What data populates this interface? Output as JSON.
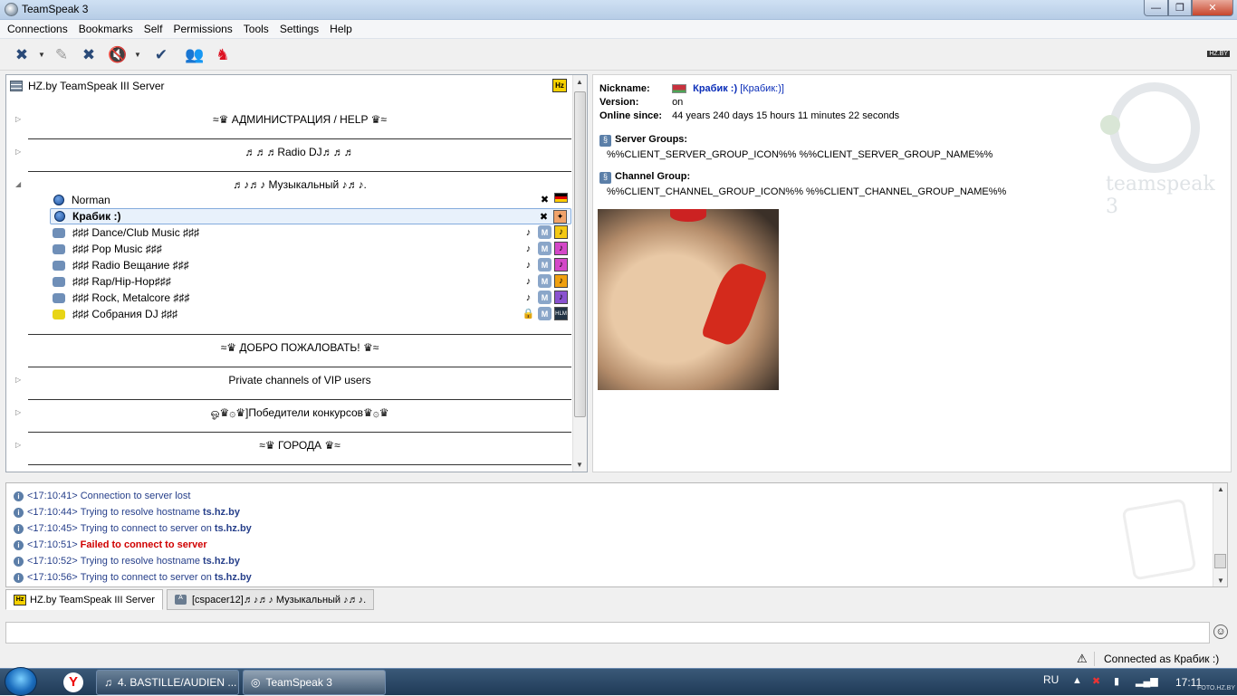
{
  "window": {
    "title": "TeamSpeak 3",
    "min": "—",
    "max": "❐",
    "close": "✕"
  },
  "menu": [
    "Connections",
    "Bookmarks",
    "Self",
    "Permissions",
    "Tools",
    "Settings",
    "Help"
  ],
  "toolbar": {
    "hz_label": "HZ.BY"
  },
  "tree": {
    "server_name": "HZ.by TeamSpeak III Server",
    "server_badge": "Hz",
    "spacers": [
      "≈♛ АДМИНИСТРАЦИЯ / HELP ♛≈",
      "♬♬♬Radio DJ♬♬♬",
      "♬♪♬♪ Музыкальный ♪♬♪.",
      "≈♛ ДОБРО ПОЖАЛОВАТЬ! ♛≈",
      "Private channels of VIP users",
      "ஓ♛۞♛]Победители конкурсов♛۞♛",
      "≈♛ ГОРОДА ♛≈"
    ],
    "clients": [
      {
        "name": "Norman"
      },
      {
        "name": "Крабик :)"
      }
    ],
    "channels": [
      {
        "name": "♯♯♯ Dance/Club Music ♯♯♯"
      },
      {
        "name": "♯♯♯ Pop Music ♯♯♯"
      },
      {
        "name": "♯♯♯ Radio Вещание ♯♯♯"
      },
      {
        "name": "♯♯♯ Rap/Hip-Hop♯♯♯"
      },
      {
        "name": "♯♯♯ Rock, Metalcore ♯♯♯"
      },
      {
        "name": "♯♯♯ Собрания DJ ♯♯♯"
      }
    ]
  },
  "info": {
    "nickname_label": "Nickname:",
    "nickname": "Крабик :)",
    "nickname_link": "[Крабик:)]",
    "version_label": "Version:",
    "version": "on",
    "online_label": "Online since:",
    "online": "44 years 240 days 15 hours 11 minutes 22 seconds",
    "server_groups_label": "Server Groups:",
    "server_groups": "%%CLIENT_SERVER_GROUP_ICON%% %%CLIENT_SERVER_GROUP_NAME%%",
    "channel_group_label": "Channel Group:",
    "channel_group": "%%CLIENT_CHANNEL_GROUP_ICON%% %%CLIENT_CHANNEL_GROUP_NAME%%",
    "logo_text": "teamspeak 3"
  },
  "log": [
    {
      "time": "<17:10:41>",
      "text": "Connection to server lost",
      "host": "",
      "error": ""
    },
    {
      "time": "<17:10:44>",
      "text": "Trying to resolve hostname",
      "host": "ts.hz.by",
      "error": ""
    },
    {
      "time": "<17:10:45>",
      "text": "Trying to connect to server on",
      "host": "ts.hz.by",
      "error": ""
    },
    {
      "time": "<17:10:51>",
      "text": "",
      "host": "",
      "error": "Failed to connect to server"
    },
    {
      "time": "<17:10:52>",
      "text": "Trying to resolve hostname",
      "host": "ts.hz.by",
      "error": ""
    },
    {
      "time": "<17:10:56>",
      "text": "Trying to connect to server on",
      "host": "ts.hz.by",
      "error": ""
    }
  ],
  "tabs": [
    {
      "label": "HZ.by TeamSpeak III Server"
    },
    {
      "label": "[cspacer12]♬♪♬♪ Музыкальный ♪♬♪."
    }
  ],
  "statusbar": {
    "connected": "Connected as Крабик :)"
  },
  "taskbar": {
    "tasks": [
      "4. BASTILLE/AUDIEN ...",
      "TeamSpeak 3"
    ],
    "lang": "RU",
    "clock": "17:11",
    "watermark": "FOTO.HZ.BY"
  },
  "colors": {
    "error": "#d00000",
    "log_text": "#263f8a",
    "link": "#0a2db8"
  }
}
